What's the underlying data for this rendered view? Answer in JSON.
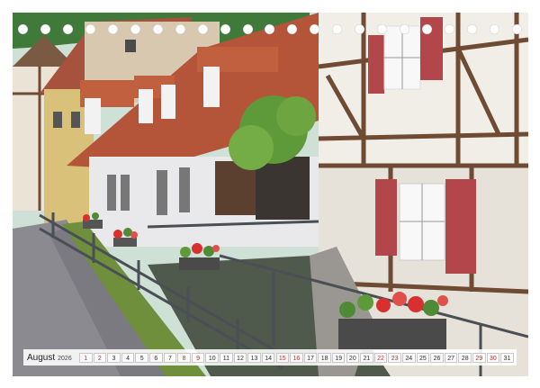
{
  "calendar": {
    "month": "August",
    "year": "2026",
    "days": [
      "1",
      "2",
      "3",
      "4",
      "5",
      "6",
      "7",
      "8",
      "9",
      "10",
      "11",
      "12",
      "13",
      "14",
      "15",
      "16",
      "17",
      "18",
      "19",
      "20",
      "21",
      "22",
      "23",
      "24",
      "25",
      "26",
      "27",
      "28",
      "29",
      "30",
      "31"
    ],
    "weekend_days": [
      "1",
      "2",
      "8",
      "9",
      "15",
      "16",
      "22",
      "23",
      "29",
      "30"
    ],
    "binding_hole_count": 23
  },
  "photo": {
    "subject": "half-timbered-houses-by-canal",
    "colors": {
      "sky": "#bcd8c4",
      "hills": "#3f7a3a",
      "roof": "#b4553a",
      "timber": "#6e4b32",
      "shutter": "#b3464a",
      "plaster": "#f1eee8",
      "cobble": "#8a8a90",
      "water": "#4f5a4c",
      "geranium": "#d8302e",
      "railing": "#4a4f55"
    }
  }
}
